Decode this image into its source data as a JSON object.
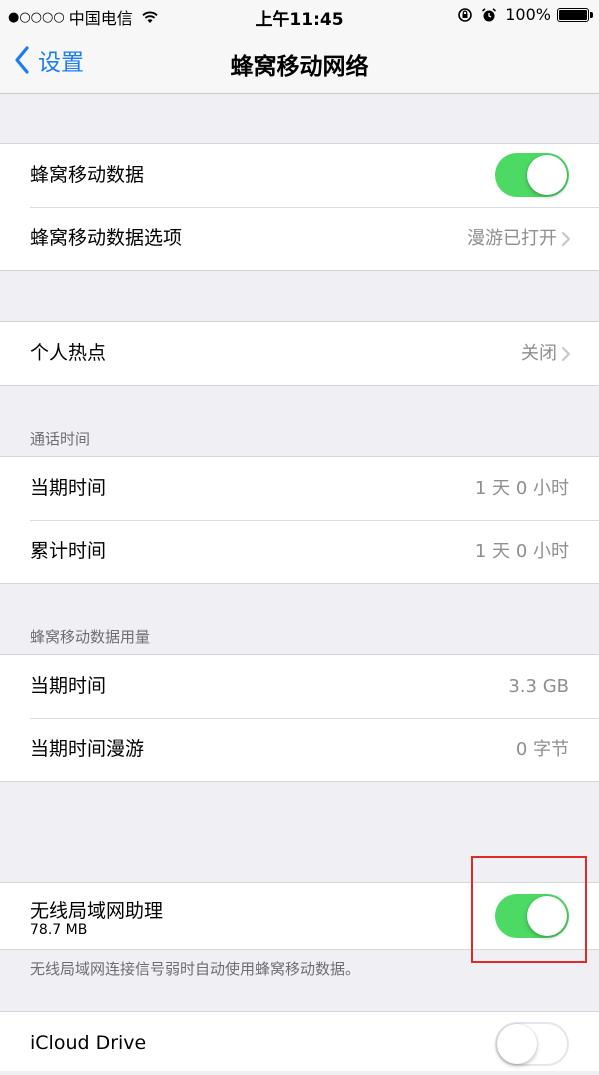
{
  "status_bar": {
    "signal": "●○○○○",
    "carrier": "中国电信",
    "time": "上午11:45",
    "battery": "100%"
  },
  "nav": {
    "back_label": "设置",
    "title": "蜂窝移动网络"
  },
  "cellular_group": {
    "row1_label": "蜂窝移动数据",
    "row1_toggle": "on",
    "row2_label": "蜂窝移动数据选项",
    "row2_detail": "漫游已打开"
  },
  "hotspot": {
    "label": "个人热点",
    "detail": "关闭"
  },
  "call_time": {
    "header": "通话时间",
    "rows": [
      {
        "label": "当期时间",
        "value": "1 天 0 小时"
      },
      {
        "label": "累计时间",
        "value": "1 天 0 小时"
      }
    ]
  },
  "data_usage": {
    "header": "蜂窝移动数据用量",
    "rows": [
      {
        "label": "当期时间",
        "value": "3.3 GB"
      },
      {
        "label": "当期时间漫游",
        "value": "0 字节"
      }
    ]
  },
  "wifi_assist": {
    "label": "无线局域网助理",
    "sublabel": "78.7 MB",
    "toggle": "on",
    "footer": "无线局域网连接信号弱时自动使用蜂窝移动数据。"
  },
  "icloud": {
    "label": "iCloud Drive",
    "toggle": "off"
  },
  "colors": {
    "accent": "#1b7cf6",
    "toggle_on": "#4cd964",
    "highlight": "#e02a2a"
  }
}
